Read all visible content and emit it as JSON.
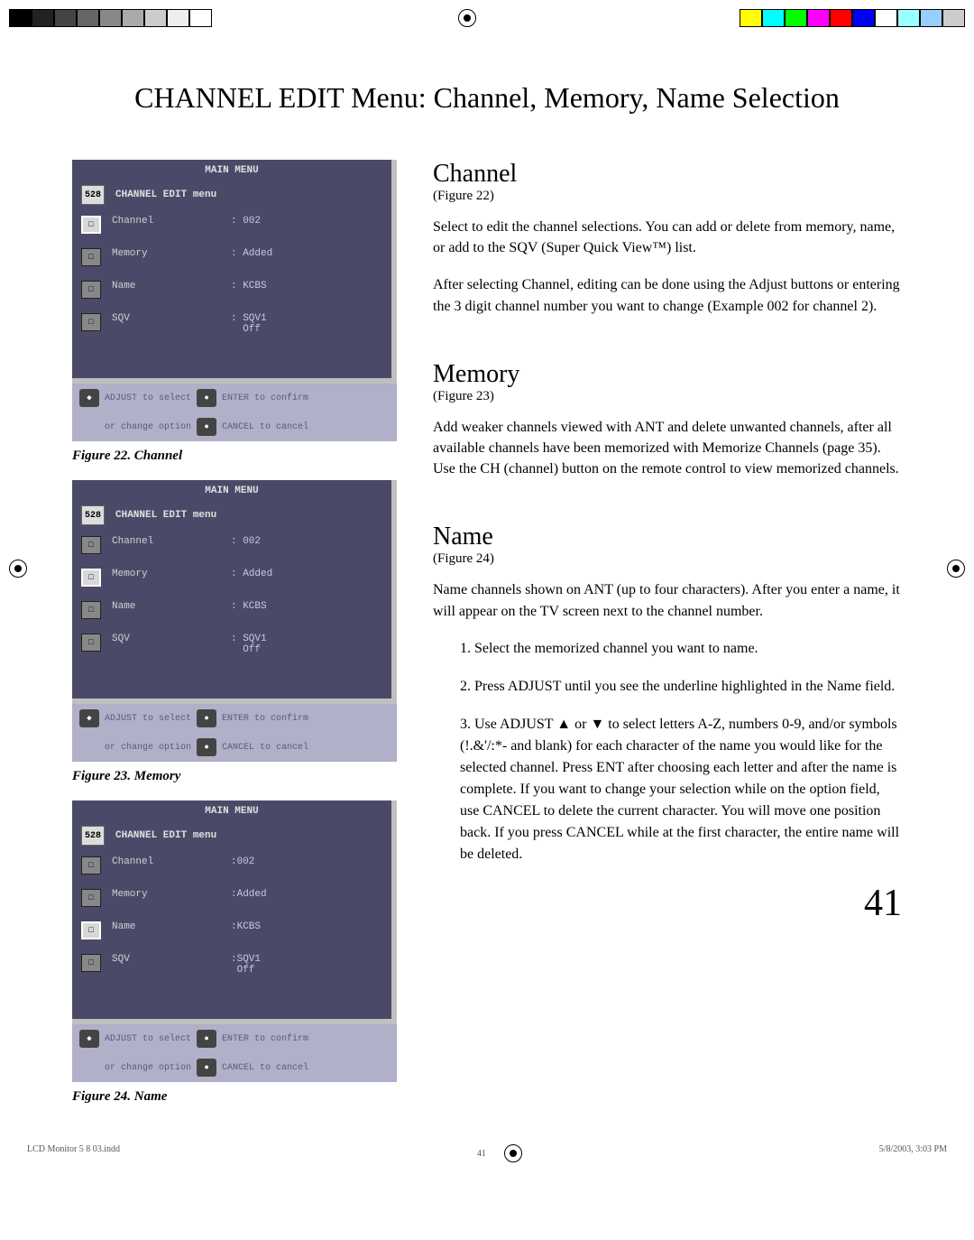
{
  "page": {
    "title": "CHANNEL EDIT Menu: Channel, Memory, Name Selection",
    "number": "41"
  },
  "tv_menus": [
    {
      "header": "MAIN MENU",
      "sub": "CHANNEL EDIT menu",
      "rows": [
        {
          "label": "Channel",
          "value": ": 002",
          "selected": true
        },
        {
          "label": "Memory",
          "value": ": Added",
          "selected": false
        },
        {
          "label": "Name",
          "value": ": KCBS",
          "selected": false
        },
        {
          "label": "SQV",
          "value": ": SQV1\n  Off",
          "selected": false
        }
      ],
      "footer": {
        "l1a": "ADJUST to select",
        "l1b": "ENTER to confirm",
        "l2a": "or change option",
        "l2b": "CANCEL to cancel"
      },
      "caption": "Figure 22.  Channel"
    },
    {
      "header": "MAIN MENU",
      "sub": "CHANNEL EDIT menu",
      "rows": [
        {
          "label": "Channel",
          "value": ": 002",
          "selected": false
        },
        {
          "label": "Memory",
          "value": ": Added",
          "selected": true
        },
        {
          "label": "Name",
          "value": ": KCBS",
          "selected": false
        },
        {
          "label": "SQV",
          "value": ": SQV1\n  Off",
          "selected": false
        }
      ],
      "footer": {
        "l1a": "ADJUST to select",
        "l1b": "ENTER to confirm",
        "l2a": "or change option",
        "l2b": "CANCEL to cancel"
      },
      "caption": "Figure 23.  Memory"
    },
    {
      "header": "MAIN MENU",
      "sub": "CHANNEL EDIT menu",
      "rows": [
        {
          "label": "Channel",
          "value": ":002",
          "selected": false
        },
        {
          "label": "Memory",
          "value": ":Added",
          "selected": false
        },
        {
          "label": "Name",
          "value": ":KCBS",
          "selected": true
        },
        {
          "label": "SQV",
          "value": ":SQV1\n Off",
          "selected": false
        }
      ],
      "footer": {
        "l1a": "ADJUST to select",
        "l1b": "ENTER to confirm",
        "l2a": "or change option",
        "l2b": "CANCEL to cancel"
      },
      "caption": "Figure 24.  Name"
    }
  ],
  "right": {
    "channel": {
      "head": "Channel",
      "sub": "(Figure 22)",
      "p1": "Select to edit the channel selections.  You can add or delete from memory, name, or add to the SQV (Super Quick View™) list.",
      "p2": "After selecting Channel, editing can be done using the Adjust buttons or entering the 3 digit channel number you want to change (Example 002 for channel 2)."
    },
    "memory": {
      "head": "Memory",
      "sub": "(Figure 23)",
      "p1": "Add weaker channels viewed with ANT and delete unwanted channels, after all available channels have been memorized with Memorize Channels (page 35).  Use the CH (channel) button on the remote control to view memorized channels."
    },
    "name": {
      "head": "Name",
      "sub": "(Figure 24)",
      "p1": "Name channels shown on ANT (up to four characters).  After you enter a name, it will appear on the TV screen next to the channel number.",
      "steps": [
        "1. Select the memorized channel you want to name.",
        "2. Press ADJUST until you see the underline highlighted in the Name field.",
        "3. Use ADJUST ▲ or ▼ to select letters A-Z, numbers 0-9, and/or symbols (!.&'/:*- and blank) for each character of the name you would like for the selected channel.  Press ENT after choosing each letter and after the name is complete. If you want to change your selection while on the option field, use CANCEL to delete the current character. You will move one position back.  If you press CANCEL while at the first character, the entire name will be deleted."
      ]
    }
  },
  "footer_meta": {
    "left": "LCD Monitor 5 8 03.indd",
    "mid": "41",
    "right": "5/8/2003, 3:03 PM"
  },
  "icons": {
    "logo_528": "528",
    "square": "□"
  }
}
